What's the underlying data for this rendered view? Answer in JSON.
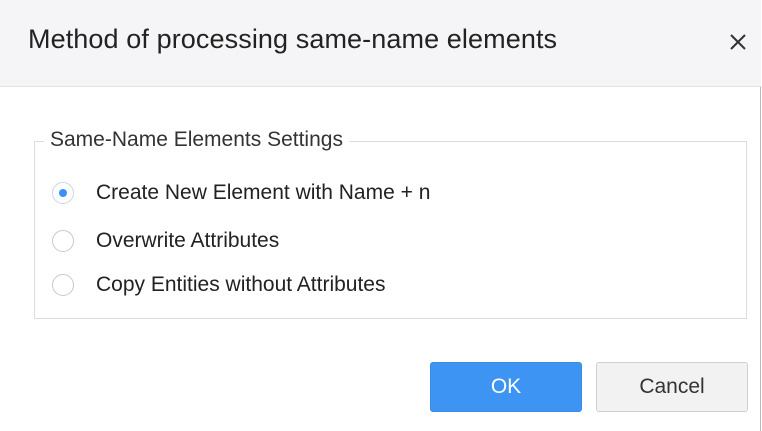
{
  "dialog": {
    "title": "Method of processing same-name elements",
    "close_icon": "close-icon"
  },
  "settings_group": {
    "legend": "Same-Name Elements Settings",
    "options": [
      {
        "label": "Create New Element with Name + n",
        "selected": true
      },
      {
        "label": "Overwrite Attributes",
        "selected": false
      },
      {
        "label": "Copy Entities without Attributes",
        "selected": false
      }
    ]
  },
  "buttons": {
    "ok_label": "OK",
    "cancel_label": "Cancel"
  },
  "colors": {
    "accent": "#3e8ef7",
    "ok_button_bg": "#3e94f3",
    "title_bar_bg": "#f5f5f7"
  }
}
